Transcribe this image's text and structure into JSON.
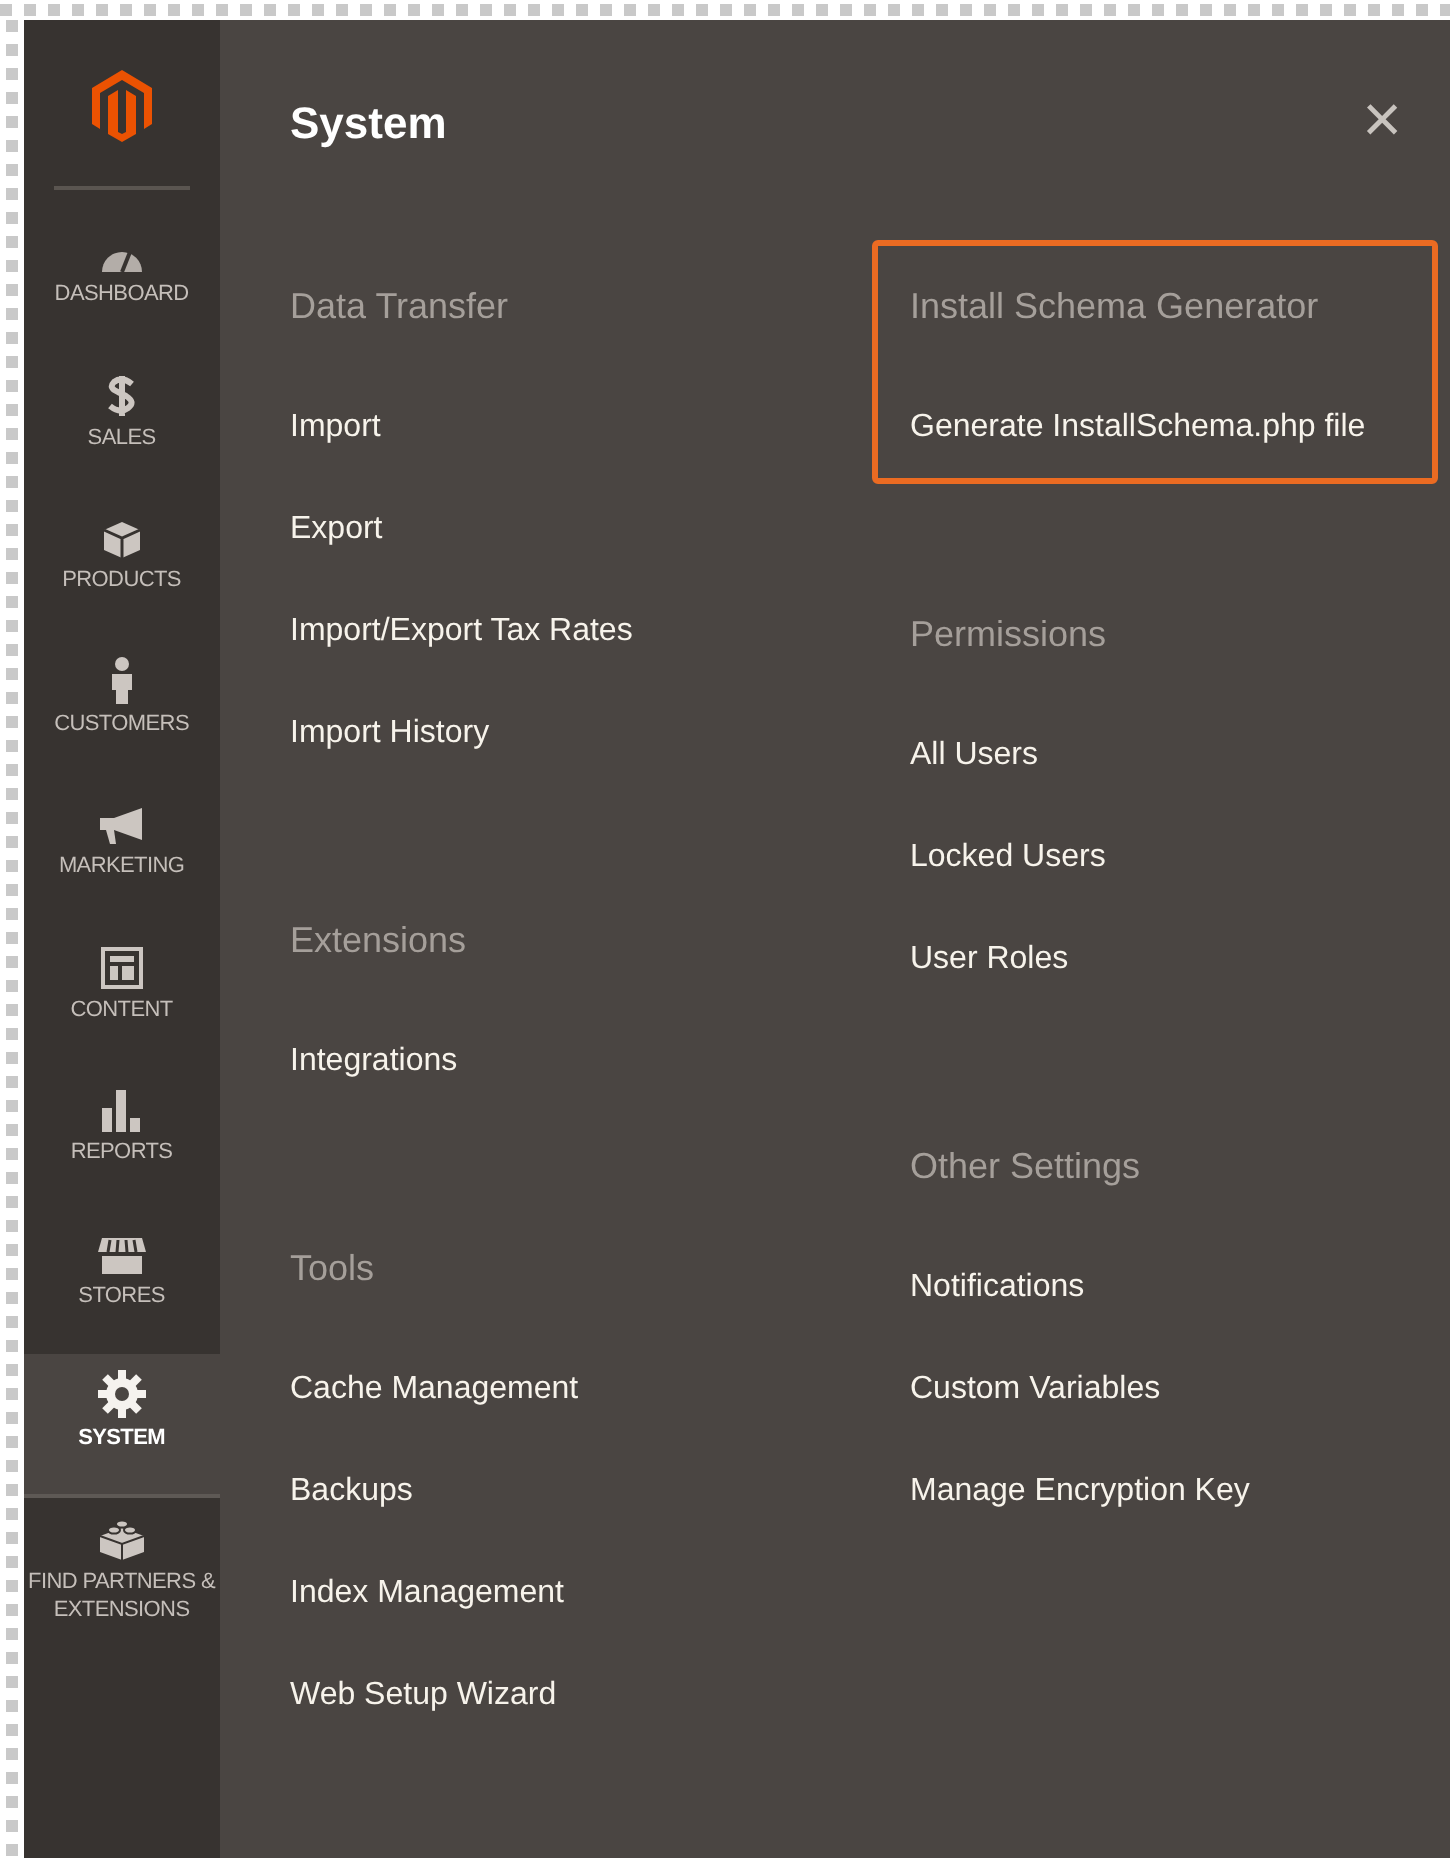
{
  "sidebar": {
    "items": [
      {
        "label": "DASHBOARD",
        "selected": false
      },
      {
        "label": "SALES",
        "selected": false
      },
      {
        "label": "PRODUCTS",
        "selected": false
      },
      {
        "label": "CUSTOMERS",
        "selected": false
      },
      {
        "label": "MARKETING",
        "selected": false
      },
      {
        "label": "CONTENT",
        "selected": false
      },
      {
        "label": "REPORTS",
        "selected": false
      },
      {
        "label": "STORES",
        "selected": false
      },
      {
        "label": "SYSTEM",
        "selected": true
      },
      {
        "label": "FIND PARTNERS & EXTENSIONS",
        "selected": false
      }
    ]
  },
  "panel": {
    "title": "System",
    "close": "×",
    "columns": [
      [
        {
          "heading": "Data Transfer",
          "highlighted": false,
          "items": [
            "Import",
            "Export",
            "Import/Export Tax Rates",
            "Import History"
          ]
        },
        {
          "heading": "Extensions",
          "highlighted": false,
          "items": [
            "Integrations"
          ]
        },
        {
          "heading": "Tools",
          "highlighted": false,
          "items": [
            "Cache Management",
            "Backups",
            "Index Management",
            "Web Setup Wizard"
          ]
        }
      ],
      [
        {
          "heading": "Install Schema Generator",
          "highlighted": true,
          "items": [
            "Generate InstallSchema.php file"
          ]
        },
        {
          "heading": "Permissions",
          "highlighted": false,
          "items": [
            "All Users",
            "Locked Users",
            "User Roles"
          ]
        },
        {
          "heading": "Other Settings",
          "highlighted": false,
          "items": [
            "Notifications",
            "Custom Variables",
            "Manage Encryption Key"
          ]
        }
      ]
    ]
  }
}
